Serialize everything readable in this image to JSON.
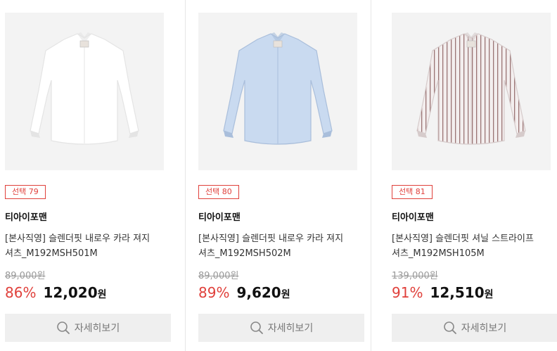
{
  "products": [
    {
      "badge": "선택 79",
      "brand": "티아이포맨",
      "name_line1": "[본사직영] 슬렌더핏 내로우 카라 져지",
      "name_line2": "셔츠_M192MSH501M",
      "original_price": "89,000원",
      "discount": "86%",
      "price": "12,020",
      "currency": "원",
      "detail_label": "자세히보기",
      "shirt_color": "#ffffff",
      "shirt_shade": "#e4e4e4",
      "stripe": false
    },
    {
      "badge": "선택 80",
      "brand": "티아이포맨",
      "name_line1": "[본사직영] 슬렌더핏 내로우 카라 져지",
      "name_line2": "셔츠_M192MSH502M",
      "original_price": "89,000원",
      "discount": "89%",
      "price": "9,620",
      "currency": "원",
      "detail_label": "자세히보기",
      "shirt_color": "#c9daf0",
      "shirt_shade": "#a9bedb",
      "stripe": false
    },
    {
      "badge": "선택 81",
      "brand": "티아이포맨",
      "name_line1": "[본사직영] 슬렌더핏 셔닐 스트라이프",
      "name_line2": "셔츠_M192MSH105M",
      "original_price": "139,000원",
      "discount": "91%",
      "price": "12,510",
      "currency": "원",
      "detail_label": "자세히보기",
      "shirt_color": "#f3eeee",
      "shirt_shade": "#d6cbcb",
      "stripe": true,
      "stripe_color": "#9a7474"
    }
  ]
}
